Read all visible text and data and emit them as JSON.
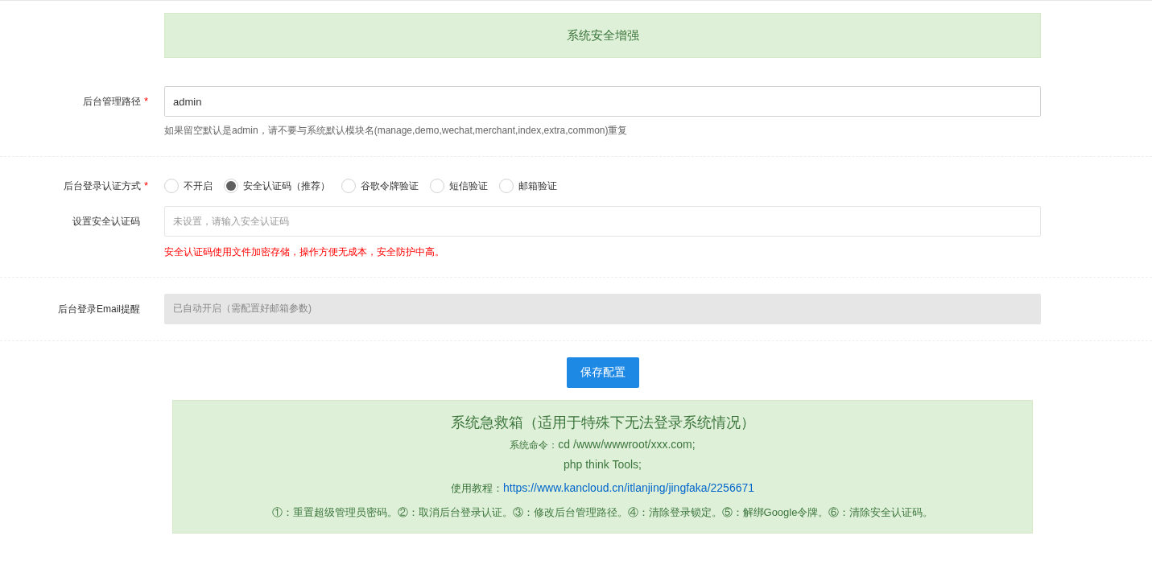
{
  "banner": {
    "title": "系统安全增强"
  },
  "admin_path": {
    "label": "后台管理路径",
    "required": "*",
    "value": "admin",
    "hint": "如果留空默认是admin，请不要与系统默认模块名(manage,demo,wechat,merchant,index,extra,common)重复"
  },
  "auth_method": {
    "label": "后台登录认证方式",
    "required": "*",
    "options": [
      {
        "label": "不开启",
        "selected": false
      },
      {
        "label": "安全认证码（推荐）",
        "selected": true
      },
      {
        "label": "谷歌令牌验证",
        "selected": false
      },
      {
        "label": "短信验证",
        "selected": false
      },
      {
        "label": "邮箱验证",
        "selected": false
      }
    ]
  },
  "security_code": {
    "label": "设置安全认证码",
    "placeholder": "未设置，请输入安全认证码",
    "hint": "安全认证码使用文件加密存储，操作方便无成本，安全防护中高。"
  },
  "email_alert": {
    "label": "后台登录Email提醒",
    "value": "已自动开启（需配置好邮箱参数)",
    "disabled": true
  },
  "save_button": "保存配置",
  "rescue": {
    "title": "系统急救箱（适用于特殊下无法登录系统情况）",
    "command_label": "系统命令：",
    "command": "cd /www/wwwroot/xxx.com;",
    "command2": "php think Tools;",
    "tutorial_label": "使用教程：",
    "tutorial_link": "https://www.kancloud.cn/itlanjing/jingfaka/2256671",
    "functions": "①：重置超级管理员密码。②：取消后台登录认证。③：修改后台管理路径。④：清除登录锁定。⑤：解绑Google令牌。⑥：清除安全认证码。"
  }
}
